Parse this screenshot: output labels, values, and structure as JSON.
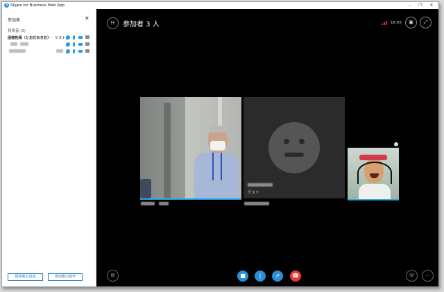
{
  "window": {
    "title": "Skype for Business Web App",
    "controls": [
      "–",
      "❐",
      "✕"
    ]
  },
  "sidebar": {
    "header": "参加者",
    "close_label": "✕",
    "section_label": "発表者 (3)",
    "participants": [
      {
        "name": "函館拓馬（とおだみきお）",
        "more": "…",
        "role": "ゲスト"
      },
      {
        "name": "",
        "role": ""
      },
      {
        "name": "",
        "role": ""
      }
    ],
    "buttons": {
      "invite": "招待者の追加",
      "actions": "参加者の操作"
    }
  },
  "stage": {
    "title": "参加者 3 人",
    "time": "16:05",
    "guest_label": "ゲスト",
    "icons": {
      "participants": "participants-icon",
      "layout": "layout-icon",
      "fullscreen": "fullscreen-icon",
      "chat": "chat-icon",
      "video": "video-icon",
      "mic": "microphone-icon",
      "share": "share-icon",
      "hangup": "hang-up-icon",
      "dialpad": "phone-icon",
      "more": "more-icon"
    }
  },
  "colors": {
    "accent": "#2a8fd6",
    "hangup": "#e03c3c",
    "signal": "#d62e2e",
    "stage_bg": "#000000"
  }
}
